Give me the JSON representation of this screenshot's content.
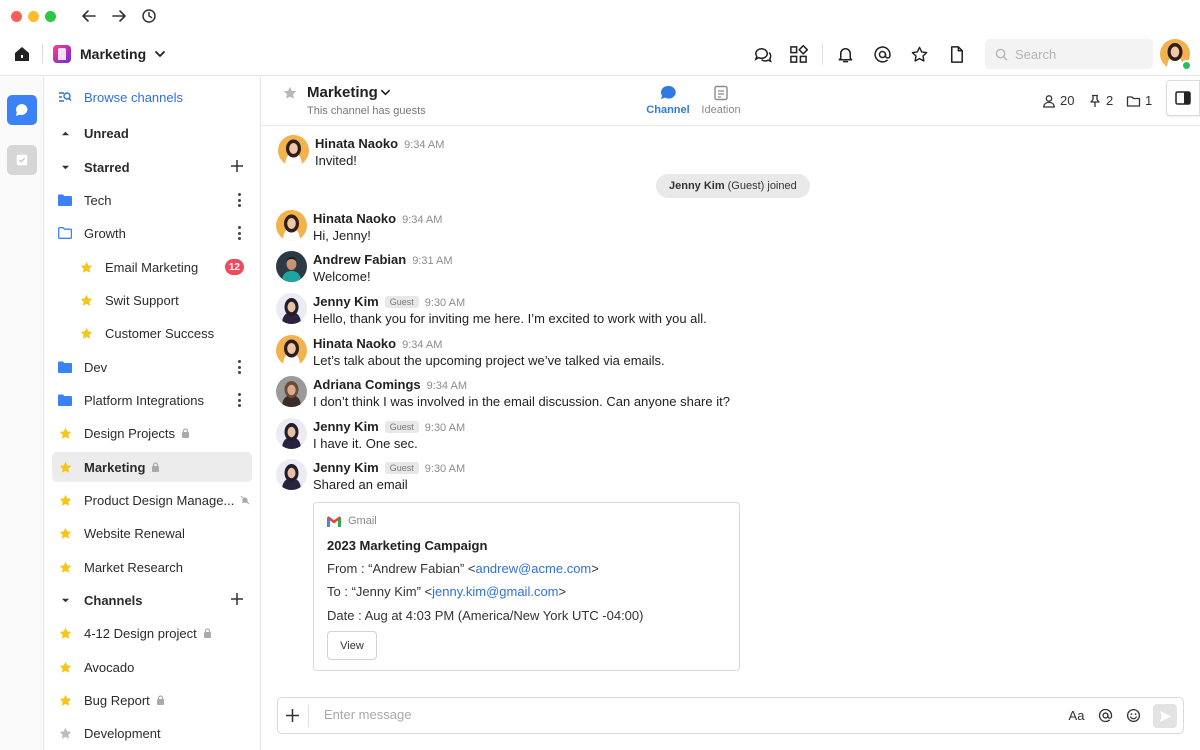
{
  "window": {
    "traffic_lights": [
      "#ff5f57",
      "#febc2e",
      "#28c840"
    ]
  },
  "workspace": {
    "name": "Marketing"
  },
  "search": {
    "placeholder": "Search"
  },
  "sidebar": {
    "browse": "Browse channels",
    "sections": {
      "unread": "Unread",
      "starred": "Starred",
      "channels": "Channels"
    },
    "items": [
      {
        "label": "Tech",
        "kind": "folder"
      },
      {
        "label": "Growth",
        "kind": "folder-open"
      },
      {
        "label": "Email Marketing",
        "kind": "star",
        "badge": "12"
      },
      {
        "label": "Swit Support",
        "kind": "star"
      },
      {
        "label": "Customer Success",
        "kind": "star"
      },
      {
        "label": "Dev",
        "kind": "folder"
      },
      {
        "label": "Platform Integrations",
        "kind": "folder"
      },
      {
        "label": "Design Projects",
        "kind": "star",
        "locked": true
      },
      {
        "label": "Marketing",
        "kind": "star",
        "locked": true,
        "active": true
      },
      {
        "label": "Product Design Manage...",
        "kind": "star",
        "muted": true
      },
      {
        "label": "Website Renewal",
        "kind": "star"
      },
      {
        "label": "Market Research",
        "kind": "star"
      },
      {
        "label": "4-12 Design project",
        "kind": "star",
        "locked": true
      },
      {
        "label": "Avocado",
        "kind": "star"
      },
      {
        "label": "Bug Report",
        "kind": "star",
        "locked": true
      },
      {
        "label": "Development",
        "kind": "star-grey"
      }
    ]
  },
  "channel": {
    "title": "Marketing",
    "subtitle": "This channel has guests",
    "tabs": [
      {
        "label": "Channel",
        "active": true
      },
      {
        "label": "Ideation",
        "active": false
      }
    ],
    "members": "20",
    "pins": "2",
    "files": "1"
  },
  "messages": [
    {
      "name": "Hinata Naoko",
      "time": "9:34 AM",
      "text": "Invited!"
    },
    {
      "name": "Hinata Naoko",
      "time": "9:34 AM",
      "text": "Hi, Jenny!"
    },
    {
      "name": "Andrew Fabian",
      "time": "9:31 AM",
      "text": "Welcome!"
    },
    {
      "name": "Jenny Kim",
      "guest": "Guest",
      "time": "9:30 AM",
      "text": "Hello, thank you for inviting me here. I’m excited to work with you all."
    },
    {
      "name": "Hinata Naoko",
      "time": "9:34 AM",
      "text": "Let’s talk about the upcoming project we’ve talked via emails."
    },
    {
      "name": "Adriana Comings",
      "time": "9:34 AM",
      "text": "I don’t think I was involved in the email discussion. Can anyone share it?"
    },
    {
      "name": "Jenny Kim",
      "guest": "Guest",
      "time": "9:30 AM",
      "text": "I have it. One sec."
    },
    {
      "name": "Jenny Kim",
      "guest": "Guest",
      "time": "9:30 AM",
      "text": "Shared an email"
    }
  ],
  "system": {
    "who": "Jenny Kim",
    "rest": "(Guest) joined"
  },
  "email_card": {
    "source": "Gmail",
    "title": "2023 Marketing Campaign",
    "from_prefix": "From : “Andrew Fabian” <",
    "from_email": "andrew@acme.com",
    "from_suffix": ">",
    "to_prefix": "To : “Jenny Kim” <",
    "to_email": "jenny.kim@gmail.com",
    "to_suffix": ">",
    "date": "Date : Aug at 4:03 PM (America/New York UTC -04:00)",
    "button": "View"
  },
  "composer": {
    "placeholder": "Enter message",
    "format_label": "Aa"
  },
  "colors": {
    "accent": "#2f7be0",
    "link": "#2f6fde",
    "badge": "#ef4a5b",
    "star": "#f5c518",
    "folder": "#3b82f6",
    "online": "#21c25e"
  }
}
